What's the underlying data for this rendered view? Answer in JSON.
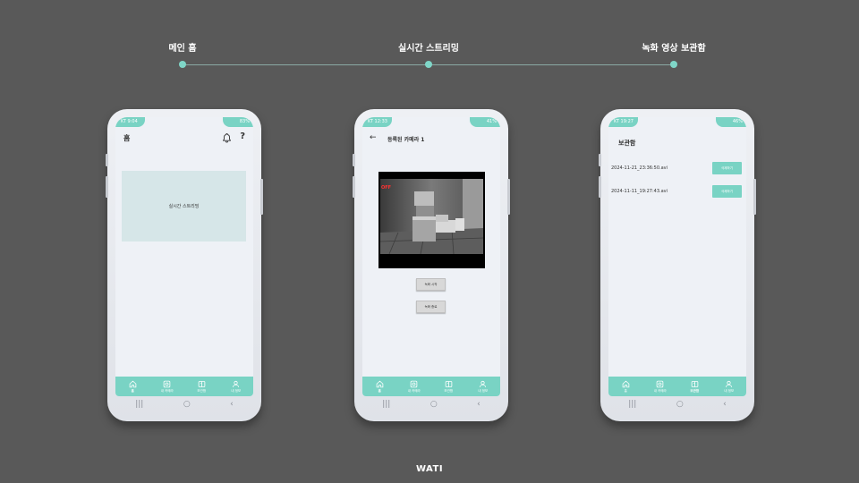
{
  "timeline": {
    "steps": [
      {
        "label": "메인 홈"
      },
      {
        "label": "실시간 스트리밍"
      },
      {
        "label": "녹화 영상 보관함"
      }
    ]
  },
  "colors": {
    "background": "#595959",
    "accent": "#79d3c4",
    "stream_card": "#d6e6e8",
    "off_label": "#ff3030"
  },
  "phones": [
    {
      "status": {
        "left": "KT 9:04",
        "right": "83%"
      },
      "screen": {
        "title": "홈",
        "help": "?",
        "stream_card_label": "실시간 스트리밍"
      },
      "nav": [
        {
          "label": "홈",
          "icon": "home-icon",
          "active": true
        },
        {
          "label": "내 카메라",
          "icon": "camera-icon",
          "active": false
        },
        {
          "label": "보관함",
          "icon": "storage-icon",
          "active": false
        },
        {
          "label": "내 정보",
          "icon": "user-icon",
          "active": false
        }
      ]
    },
    {
      "status": {
        "left": "KT 12:33",
        "right": "41%"
      },
      "screen": {
        "back": "←",
        "title": "등록된 카메라 1",
        "off_label": "OFF",
        "record_start": "녹화 시작",
        "record_stop": "녹화 종료"
      },
      "nav": [
        {
          "label": "홈",
          "icon": "home-icon",
          "active": true
        },
        {
          "label": "내 카메라",
          "icon": "camera-icon",
          "active": false
        },
        {
          "label": "보관함",
          "icon": "storage-icon",
          "active": false
        },
        {
          "label": "내 정보",
          "icon": "user-icon",
          "active": false
        }
      ]
    },
    {
      "status": {
        "left": "KT 19:27",
        "right": "46%"
      },
      "screen": {
        "title": "보관함",
        "recordings": [
          {
            "name": "2024-11-21_23:36:50.avi",
            "delete": "삭제하기"
          },
          {
            "name": "2024-11-11_19:27:43.avi",
            "delete": "삭제하기"
          }
        ]
      },
      "nav": [
        {
          "label": "홈",
          "icon": "home-icon",
          "active": false
        },
        {
          "label": "내 카메라",
          "icon": "camera-icon",
          "active": false
        },
        {
          "label": "보관함",
          "icon": "storage-icon",
          "active": true
        },
        {
          "label": "내 정보",
          "icon": "user-icon",
          "active": false
        }
      ]
    }
  ],
  "system_nav": {
    "recents": "|||",
    "home": "○",
    "back": "‹"
  },
  "brand": "WATI"
}
